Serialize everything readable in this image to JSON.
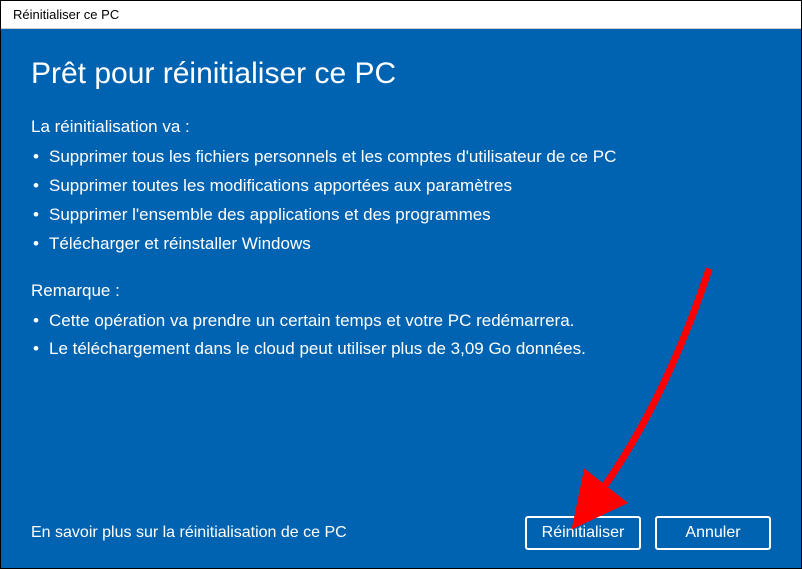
{
  "titlebar": {
    "title": "Réinitialiser ce PC"
  },
  "main": {
    "heading": "Prêt pour réinitialiser ce PC",
    "section1": {
      "intro": "La réinitialisation va :",
      "bullets": [
        "Supprimer tous les fichiers personnels et les comptes d'utilisateur de ce PC",
        "Supprimer toutes les modifications apportées aux paramètres",
        "Supprimer l'ensemble des applications et des programmes",
        "Télécharger et réinstaller Windows"
      ]
    },
    "section2": {
      "intro": "Remarque :",
      "bullets": [
        "Cette opération va prendre un certain temps et votre PC redémarrera.",
        "Le téléchargement dans le cloud peut utiliser plus de 3,09 Go données."
      ]
    }
  },
  "footer": {
    "learn_more": "En savoir plus sur la réinitialisation de ce PC",
    "reset_label": "Réinitialiser",
    "cancel_label": "Annuler"
  },
  "colors": {
    "accent": "#0063b1",
    "annotation": "#ff0000"
  }
}
